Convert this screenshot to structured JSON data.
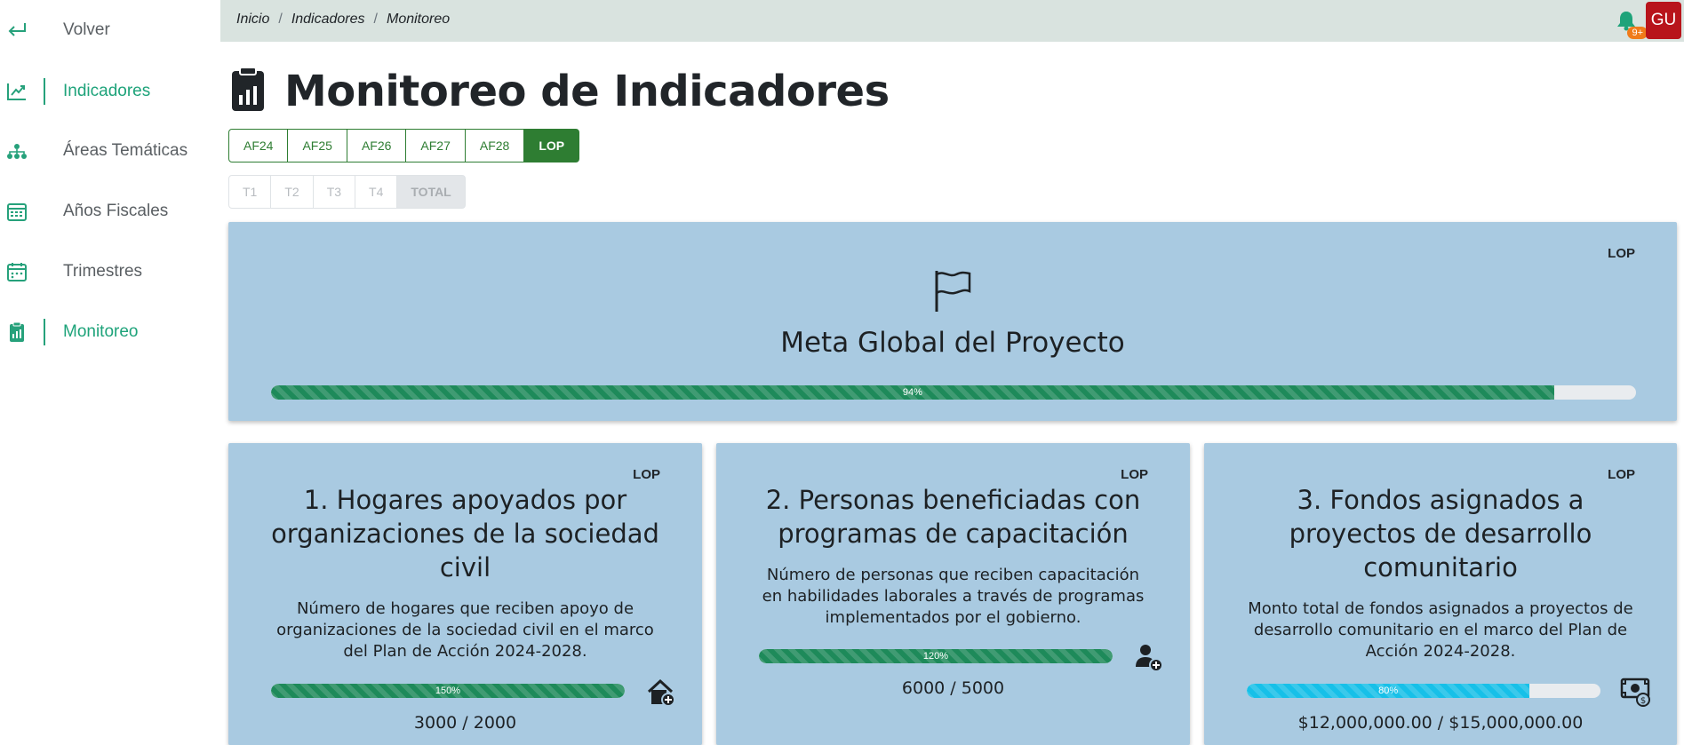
{
  "colors": {
    "accent": "#1ea37a",
    "tab_active": "#2e7d32",
    "card_bg": "#a9cae1",
    "bar_green": "#1e8a5a",
    "bar_cyan": "#17c0e8",
    "avatar": "#b8141b",
    "badge": "#f07b1a"
  },
  "sidebar": {
    "items": [
      {
        "label": "Volver",
        "icon": "return-arrow-icon",
        "active": false
      },
      {
        "label": "Indicadores",
        "icon": "trend-chart-icon",
        "active": true
      },
      {
        "label": "Áreas Temáticas",
        "icon": "sitemap-icon",
        "active": false
      },
      {
        "label": "Años Fiscales",
        "icon": "calendar-grid-icon",
        "active": false
      },
      {
        "label": "Trimestres",
        "icon": "calendar-icon",
        "active": false
      },
      {
        "label": "Monitoreo",
        "icon": "clipboard-chart-icon",
        "active": true
      }
    ]
  },
  "topbar": {
    "breadcrumb": [
      "Inicio",
      "Indicadores",
      "Monitoreo"
    ],
    "notification_badge": "9+",
    "avatar_initials": "GU"
  },
  "page": {
    "title": "Monitoreo de Indicadores",
    "title_icon": "clipboard-chart-icon"
  },
  "year_tabs": [
    {
      "label": "AF24",
      "active": false
    },
    {
      "label": "AF25",
      "active": false
    },
    {
      "label": "AF26",
      "active": false
    },
    {
      "label": "AF27",
      "active": false
    },
    {
      "label": "AF28",
      "active": false
    },
    {
      "label": "LOP",
      "active": true
    }
  ],
  "quarter_tabs": [
    {
      "label": "T1",
      "active": false
    },
    {
      "label": "T2",
      "active": false
    },
    {
      "label": "T3",
      "active": false
    },
    {
      "label": "T4",
      "active": false
    },
    {
      "label": "TOTAL",
      "active": true
    }
  ],
  "global": {
    "tag": "LOP",
    "icon": "flag-icon",
    "title": "Meta Global del Proyecto",
    "progress": 0.94,
    "progress_label": "94%"
  },
  "indicators": [
    {
      "tag": "LOP",
      "title": "1. Hogares apoyados por organizaciones de la sociedad civil",
      "description": "Número de hogares que reciben apoyo de organizaciones de la sociedad civil en el marco del Plan de Acción 2024-2028.",
      "progress": 1.0,
      "progress_label": "150%",
      "value": "3000 / 2000",
      "icon": "house-plus-icon",
      "bar_color": "#1e8a5a"
    },
    {
      "tag": "LOP",
      "title": "2. Personas beneficiadas con programas de capacitación",
      "description": "Número de personas que reciben capacitación en habilidades laborales a través de programas implementados por el gobierno.",
      "progress": 1.0,
      "progress_label": "120%",
      "value": "6000 / 5000",
      "icon": "user-plus-icon",
      "bar_color": "#1e8a5a"
    },
    {
      "tag": "LOP",
      "title": "3. Fondos asignados a proyectos de desarrollo comunitario",
      "description": "Monto total de fondos asignados a proyectos de desarrollo comunitario en el marco del Plan de Acción 2024-2028.",
      "progress": 0.8,
      "progress_label": "80%",
      "value": "$12,000,000.00 / $15,000,000.00",
      "icon": "money-bill-icon",
      "bar_color": "#17c0e8"
    }
  ]
}
